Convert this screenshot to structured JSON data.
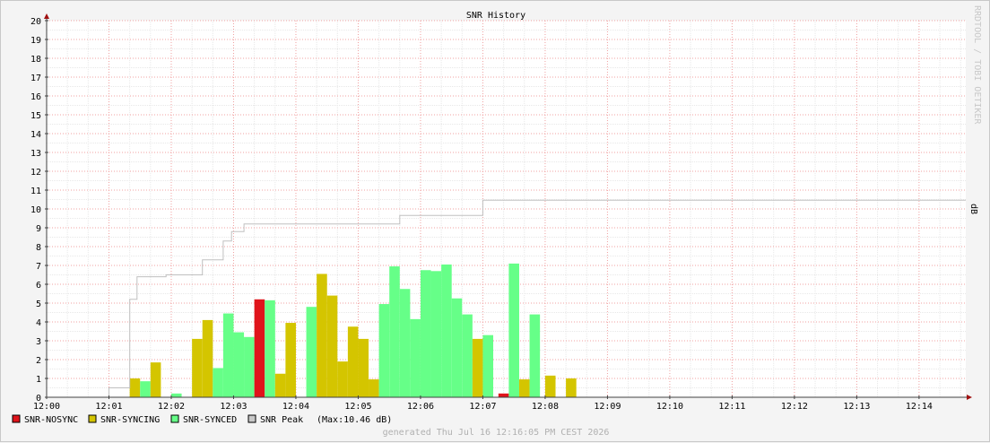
{
  "chart_data": {
    "type": "bar",
    "title": "SNR History",
    "watermark": "RRDTOOL / TOBI OETIKER",
    "ylabel": "dB",
    "ylim": [
      0,
      20
    ],
    "yticks": [
      0,
      1,
      2,
      3,
      4,
      5,
      6,
      7,
      8,
      9,
      10,
      11,
      12,
      13,
      14,
      15,
      16,
      17,
      18,
      19,
      20
    ],
    "x_ticks": [
      "12:00",
      "12:01",
      "12:02",
      "12:03",
      "12:04",
      "12:05",
      "12:06",
      "12:07",
      "12:08",
      "12:09",
      "12:10",
      "12:11",
      "12:12",
      "12:13",
      "12:14"
    ],
    "x_range_seconds": [
      0,
      885
    ],
    "bar_width_seconds": 10,
    "state_colors": {
      "SNR-NOSYNC": "#e0141b",
      "SNR-SYNCING": "#d4c500",
      "SNR-SYNCED": "#66ff88",
      "SNR Peak": "#c8c8c8"
    },
    "bars": [
      {
        "t": 80,
        "v": 1.0,
        "state": "SNR-SYNCING"
      },
      {
        "t": 90,
        "v": 0.85,
        "state": "SNR-SYNCED"
      },
      {
        "t": 100,
        "v": 1.85,
        "state": "SNR-SYNCING"
      },
      {
        "t": 120,
        "v": 0.2,
        "state": "SNR-SYNCED"
      },
      {
        "t": 140,
        "v": 3.1,
        "state": "SNR-SYNCING"
      },
      {
        "t": 150,
        "v": 4.1,
        "state": "SNR-SYNCING"
      },
      {
        "t": 160,
        "v": 1.55,
        "state": "SNR-SYNCED"
      },
      {
        "t": 170,
        "v": 4.45,
        "state": "SNR-SYNCED"
      },
      {
        "t": 180,
        "v": 3.45,
        "state": "SNR-SYNCED"
      },
      {
        "t": 190,
        "v": 3.2,
        "state": "SNR-SYNCED"
      },
      {
        "t": 200,
        "v": 5.2,
        "state": "SNR-NOSYNC"
      },
      {
        "t": 210,
        "v": 5.15,
        "state": "SNR-SYNCED"
      },
      {
        "t": 220,
        "v": 1.25,
        "state": "SNR-SYNCING"
      },
      {
        "t": 230,
        "v": 3.95,
        "state": "SNR-SYNCING"
      },
      {
        "t": 250,
        "v": 4.8,
        "state": "SNR-SYNCED"
      },
      {
        "t": 260,
        "v": 6.55,
        "state": "SNR-SYNCING"
      },
      {
        "t": 270,
        "v": 5.4,
        "state": "SNR-SYNCING"
      },
      {
        "t": 280,
        "v": 1.9,
        "state": "SNR-SYNCING"
      },
      {
        "t": 290,
        "v": 3.75,
        "state": "SNR-SYNCING"
      },
      {
        "t": 300,
        "v": 3.1,
        "state": "SNR-SYNCING"
      },
      {
        "t": 310,
        "v": 0.95,
        "state": "SNR-SYNCING"
      },
      {
        "t": 320,
        "v": 4.95,
        "state": "SNR-SYNCED"
      },
      {
        "t": 330,
        "v": 6.95,
        "state": "SNR-SYNCED"
      },
      {
        "t": 340,
        "v": 5.75,
        "state": "SNR-SYNCED"
      },
      {
        "t": 350,
        "v": 4.15,
        "state": "SNR-SYNCED"
      },
      {
        "t": 360,
        "v": 6.75,
        "state": "SNR-SYNCED"
      },
      {
        "t": 370,
        "v": 6.7,
        "state": "SNR-SYNCED"
      },
      {
        "t": 380,
        "v": 7.05,
        "state": "SNR-SYNCED"
      },
      {
        "t": 390,
        "v": 5.25,
        "state": "SNR-SYNCED"
      },
      {
        "t": 400,
        "v": 4.4,
        "state": "SNR-SYNCED"
      },
      {
        "t": 410,
        "v": 3.1,
        "state": "SNR-SYNCING"
      },
      {
        "t": 420,
        "v": 3.3,
        "state": "SNR-SYNCED"
      },
      {
        "t": 435,
        "v": 0.2,
        "state": "SNR-NOSYNC"
      },
      {
        "t": 445,
        "v": 7.1,
        "state": "SNR-SYNCED"
      },
      {
        "t": 455,
        "v": 0.95,
        "state": "SNR-SYNCING"
      },
      {
        "t": 465,
        "v": 4.4,
        "state": "SNR-SYNCED"
      },
      {
        "t": 480,
        "v": 1.15,
        "state": "SNR-SYNCING"
      },
      {
        "t": 500,
        "v": 1.0,
        "state": "SNR-SYNCING"
      }
    ],
    "peak_line": {
      "name": "SNR Peak",
      "x": [
        0,
        60,
        60,
        80,
        80,
        87,
        87,
        115,
        115,
        150,
        150,
        170,
        170,
        178,
        178,
        190,
        190,
        340,
        340,
        420,
        420,
        885
      ],
      "y": [
        0,
        0,
        0.5,
        0.5,
        5.2,
        5.2,
        6.4,
        6.4,
        6.5,
        6.5,
        7.3,
        7.3,
        8.3,
        8.3,
        8.8,
        8.8,
        9.2,
        9.2,
        9.65,
        9.65,
        10.46,
        10.46
      ]
    },
    "legend": [
      {
        "label": "SNR-NOSYNC"
      },
      {
        "label": "SNR-SYNCING"
      },
      {
        "label": "SNR-SYNCED"
      },
      {
        "label": "SNR Peak"
      }
    ],
    "peak_max_text": "(Max:10.46 dB)",
    "footer": "generated Thu Jul 16 12:16:05 PM CEST 2026"
  }
}
